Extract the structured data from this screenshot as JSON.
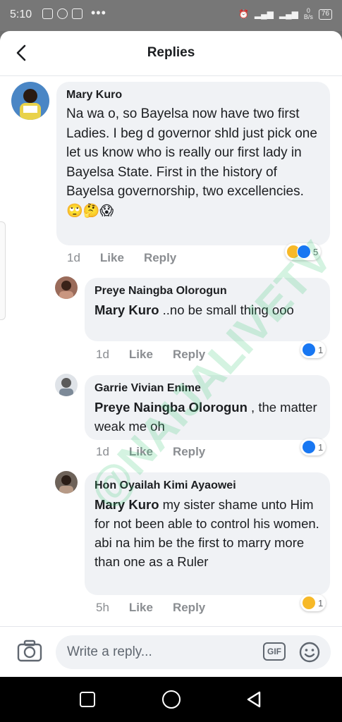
{
  "status_bar": {
    "time": "5:10",
    "overflow": "•••",
    "data_rate_top": "0",
    "data_rate_unit": "B/s",
    "battery": "76"
  },
  "header": {
    "title": "Replies"
  },
  "comments": [
    {
      "author": "Mary Kuro",
      "text": "Na wa o, so Bayelsa now have two first Ladies. I beg d governor shld just pick one let us know who is really our first lady in Bayelsa State. First in the history of Bayelsa governorship, two excellencies.",
      "emoji": "🙄🤔😱",
      "time": "1d",
      "like": "Like",
      "reply": "Reply",
      "reaction_count": "5"
    },
    {
      "author": "Preye Naingba Olorogun",
      "mention": "Mary Kuro",
      "text": " ..no be small thing ooo",
      "time": "1d",
      "like": "Like",
      "reply": "Reply",
      "reaction_count": "1"
    },
    {
      "author": "Garrie Vivian Enime",
      "mention": "Preye Naingba Olorogun",
      "text": " , the matter weak me oh",
      "time": "1d",
      "like": "Like",
      "reply": "Reply",
      "reaction_count": "1"
    },
    {
      "author": "Hon Oyailah Kimi Ayaowei",
      "mention": "Mary Kuro",
      "text": " my sister shame unto Him for not been able to control his women. abi na him be the first to marry more than one as a Ruler",
      "time": "5h",
      "like": "Like",
      "reply": "Reply",
      "reaction_count": "1"
    }
  ],
  "watermark": "@NAIJALIVETV",
  "composer": {
    "placeholder": "Write a reply...",
    "gif_label": "GIF"
  },
  "colors": {
    "like_blue": "#1877f2",
    "bubble_gray": "#f0f2f5",
    "meta_gray": "#8a8d91"
  }
}
